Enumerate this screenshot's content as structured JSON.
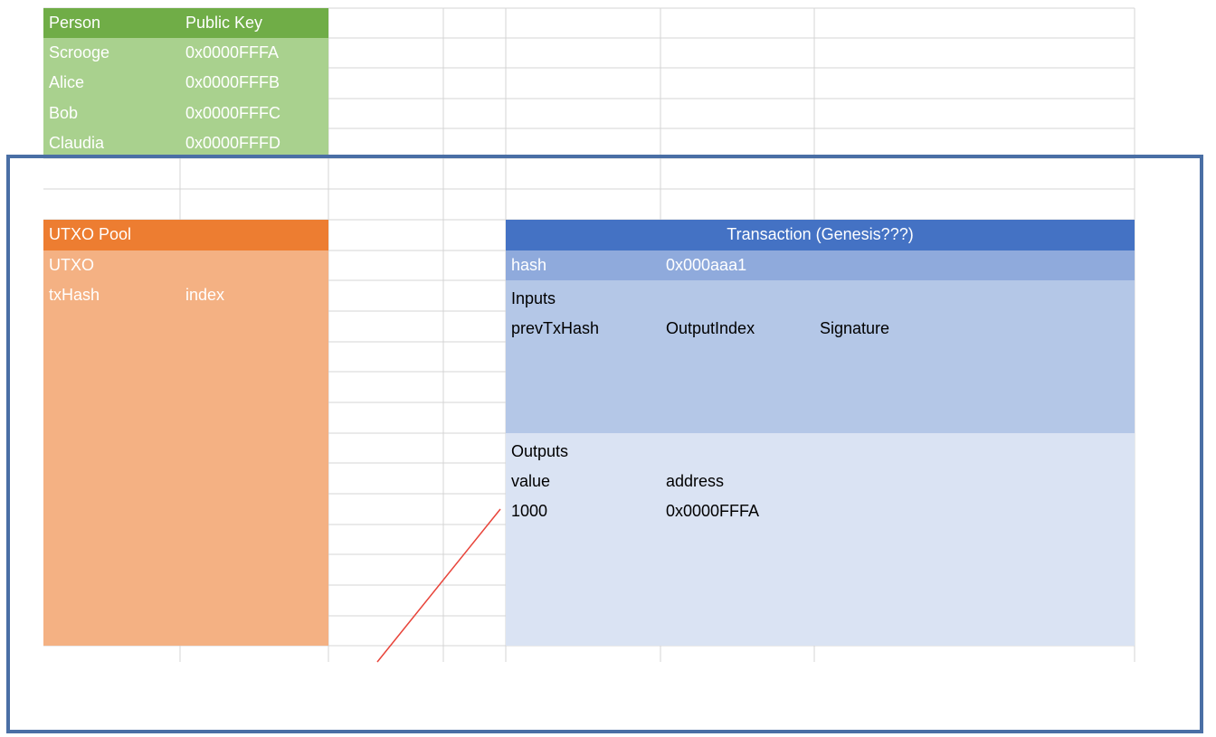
{
  "person_table": {
    "header_person": "Person",
    "header_key": "Public Key",
    "rows": [
      {
        "name": "Scrooge",
        "key": "0x0000FFFA"
      },
      {
        "name": "Alice",
        "key": "0x0000FFFB"
      },
      {
        "name": "Bob",
        "key": "0x0000FFFC"
      },
      {
        "name": "Claudia",
        "key": "0x0000FFFD"
      }
    ]
  },
  "utxo_pool": {
    "title": "UTXO Pool",
    "subtitle": "UTXO",
    "col_txhash": "txHash",
    "col_index": "index"
  },
  "transaction": {
    "title": "Transaction (Genesis???)",
    "hash_label": "hash",
    "hash_value": "0x000aaa1",
    "inputs_label": "Inputs",
    "inputs_cols": [
      "prevTxHash",
      "OutputIndex",
      "Signature"
    ],
    "outputs_label": "Outputs",
    "outputs_col_value": "value",
    "outputs_col_address": "address",
    "output_value": "1000",
    "output_address": "0x0000FFFA"
  },
  "colors": {
    "green_dark": "#70ad47",
    "green_light": "#a9d18e",
    "orange_dark": "#ed7d31",
    "orange_light": "#f4b183",
    "blue_dark": "#4472c4",
    "blue_mid": "#8faadc",
    "blue_light": "#b4c7e7",
    "blue_pale": "#dae3f3",
    "frame": "#4a6fa5",
    "arrow": "#e8443a"
  }
}
